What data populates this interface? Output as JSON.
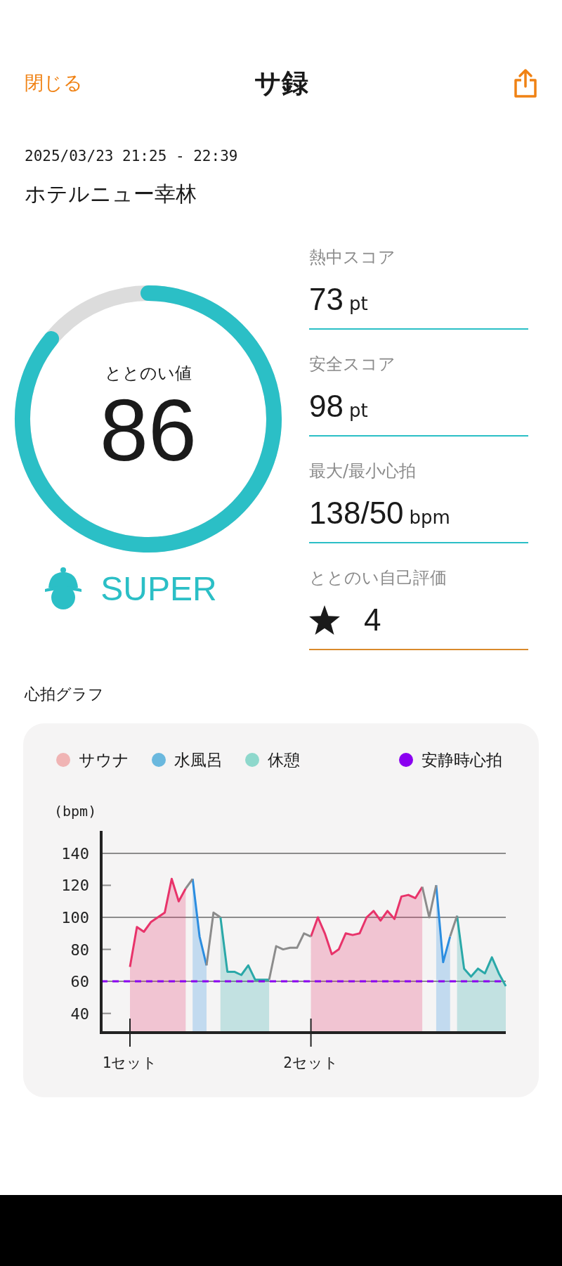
{
  "header": {
    "close": "閉じる",
    "title": "サ録"
  },
  "session": {
    "datetime": "2025/03/23 21:25 - 22:39",
    "facility": "ホテルニュー幸林"
  },
  "gauge": {
    "label": "ととのい値",
    "value": "86",
    "rank": "SUPER"
  },
  "stats": [
    {
      "kind": "score",
      "label": "熱中スコア",
      "value": "73",
      "unit": "pt"
    },
    {
      "kind": "score",
      "label": "安全スコア",
      "value": "98",
      "unit": "pt"
    },
    {
      "kind": "score",
      "label": "最大/最小心拍",
      "value": "138/50",
      "unit": "bpm"
    },
    {
      "kind": "rating",
      "label": "ととのい自己評価",
      "value": "4"
    }
  ],
  "heart_graph": {
    "title": "心拍グラフ",
    "legend": [
      {
        "kind": "area",
        "label": "サウナ",
        "color": "#f0b4b4"
      },
      {
        "kind": "area",
        "label": "水風呂",
        "color": "#6ab8de"
      },
      {
        "kind": "area",
        "label": "休憩",
        "color": "#8ed8cc"
      },
      {
        "kind": "reference",
        "label": "安静時心拍",
        "color": "#8a00f0"
      }
    ],
    "chart_data": {
      "type": "area",
      "ylabel": "(bpm)",
      "ylim": [
        28,
        154
      ],
      "grid": true,
      "yticks": [
        140,
        120,
        100,
        80,
        60,
        40
      ],
      "categories": [
        "1セット",
        null,
        null,
        null,
        null,
        null,
        null,
        null,
        null,
        null,
        null,
        null,
        null,
        null,
        null,
        null,
        null,
        null,
        null,
        null,
        null,
        null,
        null,
        null,
        null,
        null,
        "2セット",
        null,
        null,
        null,
        null,
        null,
        null,
        null,
        null,
        null,
        null,
        null,
        null,
        null,
        null,
        null,
        null,
        null,
        null,
        null,
        null,
        null,
        null,
        null,
        null,
        null,
        null,
        null,
        null
      ],
      "series": [
        {
          "color": "#e8336a",
          "values": [
            69,
            94,
            91,
            97,
            100,
            103,
            124,
            110,
            118,
            null,
            null,
            null,
            null,
            null,
            null,
            null,
            null,
            null,
            null,
            null,
            null,
            null,
            null,
            null,
            null,
            null,
            88,
            100,
            90,
            77,
            80,
            90,
            89,
            90,
            100,
            104,
            98,
            104,
            99,
            113,
            114,
            112,
            119,
            null,
            null,
            null,
            null,
            null,
            null,
            null,
            null,
            null,
            null,
            null,
            null
          ]
        },
        {
          "color": "#2b8de0",
          "values": [
            null,
            null,
            null,
            null,
            null,
            null,
            null,
            null,
            null,
            124,
            88,
            70,
            null,
            null,
            null,
            null,
            null,
            null,
            null,
            null,
            null,
            null,
            null,
            null,
            null,
            null,
            null,
            null,
            null,
            null,
            null,
            null,
            null,
            null,
            null,
            null,
            null,
            null,
            null,
            null,
            null,
            null,
            null,
            null,
            120,
            72,
            88,
            null,
            null,
            null,
            null,
            null,
            null,
            null,
            null
          ]
        },
        {
          "color": "#2aa8a8",
          "values": [
            null,
            null,
            null,
            null,
            null,
            null,
            null,
            null,
            null,
            null,
            null,
            null,
            null,
            100,
            66,
            66,
            64,
            70,
            61,
            61,
            61,
            null,
            null,
            null,
            null,
            null,
            null,
            null,
            null,
            null,
            null,
            null,
            null,
            null,
            null,
            null,
            null,
            null,
            null,
            null,
            null,
            null,
            null,
            null,
            null,
            null,
            null,
            101,
            68,
            63,
            68,
            65,
            75,
            65,
            57
          ]
        },
        {
          "type": "line",
          "color": "#8c8c8c",
          "values": [
            null,
            null,
            null,
            null,
            null,
            null,
            null,
            null,
            118,
            124,
            null,
            70,
            103,
            100,
            null,
            null,
            null,
            null,
            null,
            null,
            61,
            82,
            80,
            81,
            81,
            90,
            88,
            null,
            null,
            null,
            null,
            null,
            null,
            null,
            null,
            null,
            null,
            null,
            null,
            null,
            null,
            null,
            119,
            100,
            120,
            null,
            88,
            101,
            null,
            null,
            null,
            null,
            null,
            null,
            null
          ]
        }
      ],
      "ref_lines": [
        {
          "axis": "y",
          "value": 60,
          "color": "#8a00f0"
        }
      ]
    }
  }
}
